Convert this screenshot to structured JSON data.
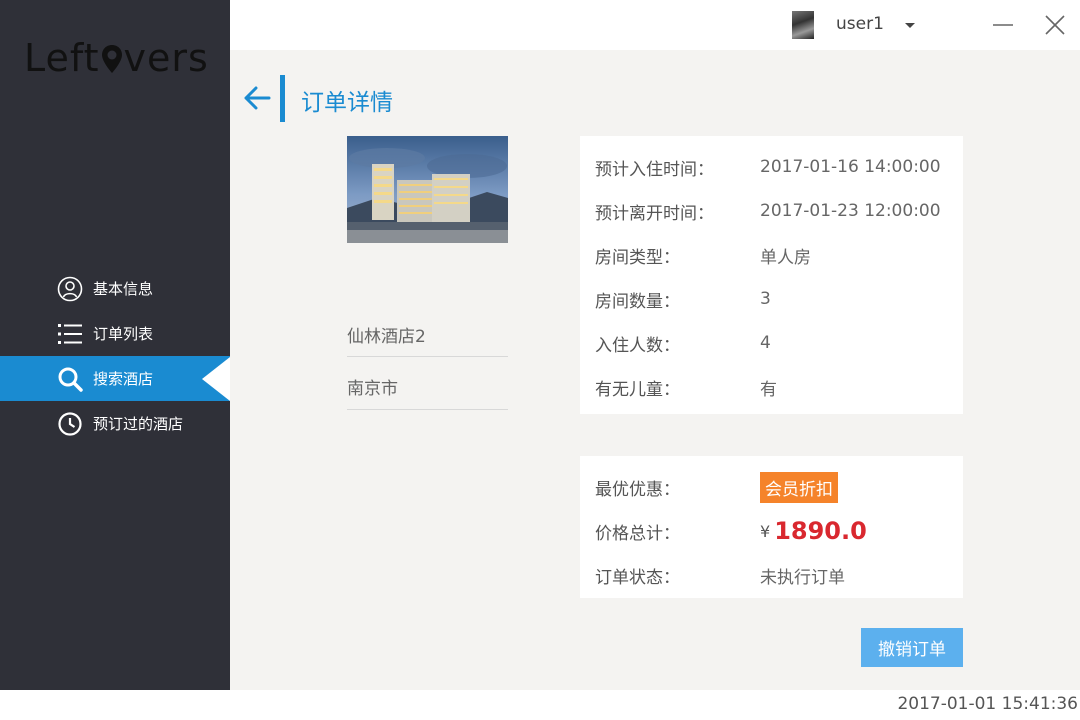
{
  "app": {
    "logo_text_left": "Left",
    "logo_text_right": "vers",
    "brand_color": "#1a8bd1"
  },
  "topbar": {
    "username": "user1",
    "avatar_icon": "user-avatar",
    "dropdown_icon": "caret-down-icon",
    "minimize_icon": "minimize-icon",
    "close_icon": "close-icon"
  },
  "sidebar": {
    "items": [
      {
        "label": "基本信息",
        "icon": "user-circle-icon",
        "active": false
      },
      {
        "label": "订单列表",
        "icon": "list-icon",
        "active": false
      },
      {
        "label": "搜索酒店",
        "icon": "search-icon",
        "active": true
      },
      {
        "label": "预订过的酒店",
        "icon": "clock-icon",
        "active": false
      }
    ]
  },
  "page": {
    "title": "订单详情",
    "back_icon": "arrow-left-icon"
  },
  "hotel": {
    "name": "仙林酒店2",
    "city": "南京市"
  },
  "order_details": {
    "checkin_label": "预计入住时间：",
    "checkin_value": "2017-01-16 14:00:00",
    "checkout_label": "预计离开时间：",
    "checkout_value": "2017-01-23 12:00:00",
    "room_type_label": "房间类型：",
    "room_type_value": "单人房",
    "room_count_label": "房间数量：",
    "room_count_value": "3",
    "guests_label": "入住人数：",
    "guests_value": "4",
    "children_label": "有无儿童：",
    "children_value": "有"
  },
  "pricing": {
    "discount_label": "最优优惠：",
    "discount_value": "会员折扣",
    "total_label": "价格总计：",
    "currency": "¥",
    "total_value": "1890.0",
    "status_label": "订单状态：",
    "status_value": "未执行订单",
    "colors": {
      "badge": "#f5832a",
      "price": "#d9282f",
      "status": "#f29d1b"
    }
  },
  "actions": {
    "cancel_label": "撤销订单"
  },
  "footer": {
    "timestamp": "2017-01-01 15:41:36"
  }
}
